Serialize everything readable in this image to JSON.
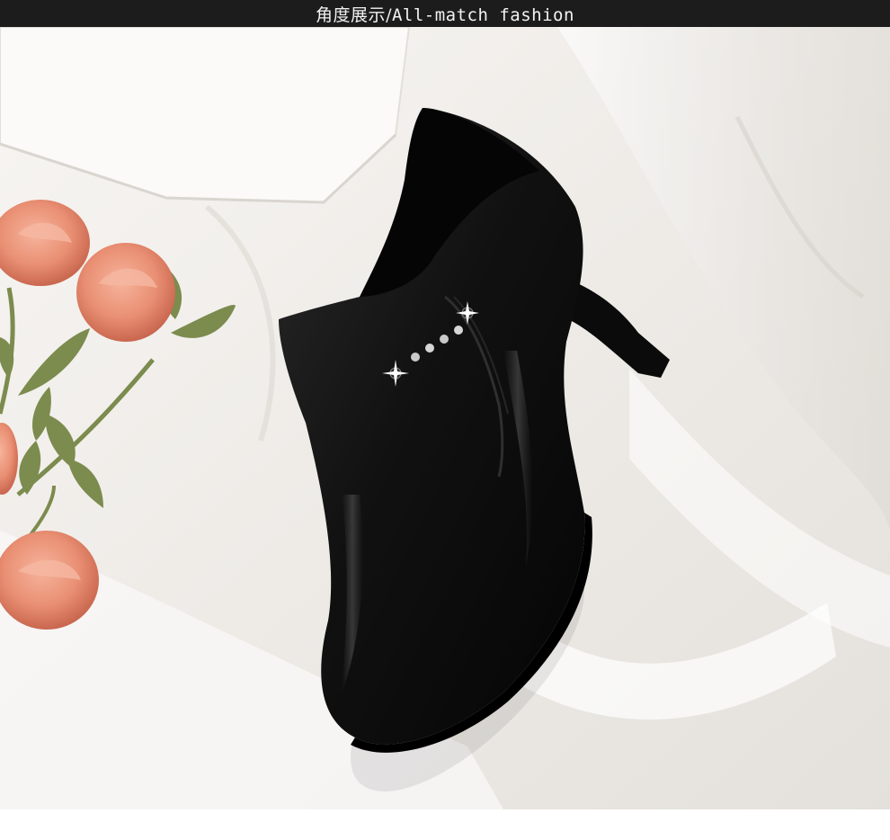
{
  "banner": {
    "title_cn": "角度展示",
    "title_sep": "/",
    "title_en": "All-match fashion"
  },
  "photo": {
    "subject": "black leather ankle boot with stiletto heel",
    "colors": {
      "background": "#f3f1ee",
      "boot": "#0e0e0e",
      "rose": "#e98f73",
      "leaf": "#7c8b4e"
    }
  }
}
